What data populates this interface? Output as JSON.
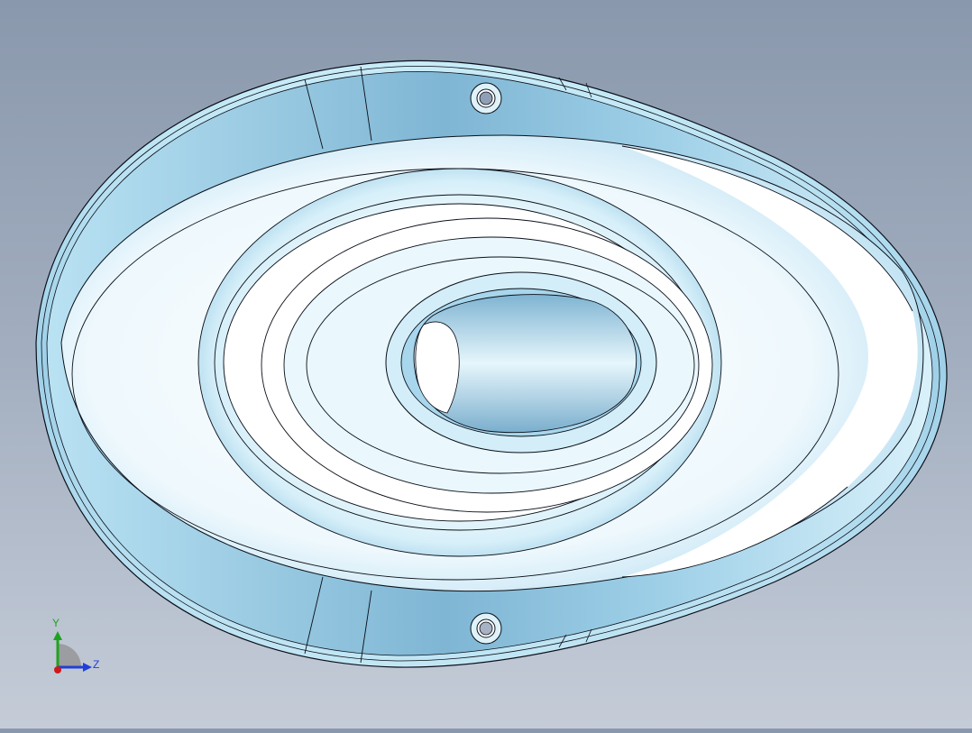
{
  "viewport": {
    "background_top": "#8a98ad",
    "background_bottom": "#c5ccd8",
    "part_color": "#a8d6ec",
    "part_highlight": "#ffffff",
    "edge_color": "#0a0f18"
  },
  "triad": {
    "y_label": "Y",
    "z_label": "Z",
    "y_color": "#1fa31f",
    "z_color": "#1f3fd8",
    "x_color": "#d01818"
  }
}
